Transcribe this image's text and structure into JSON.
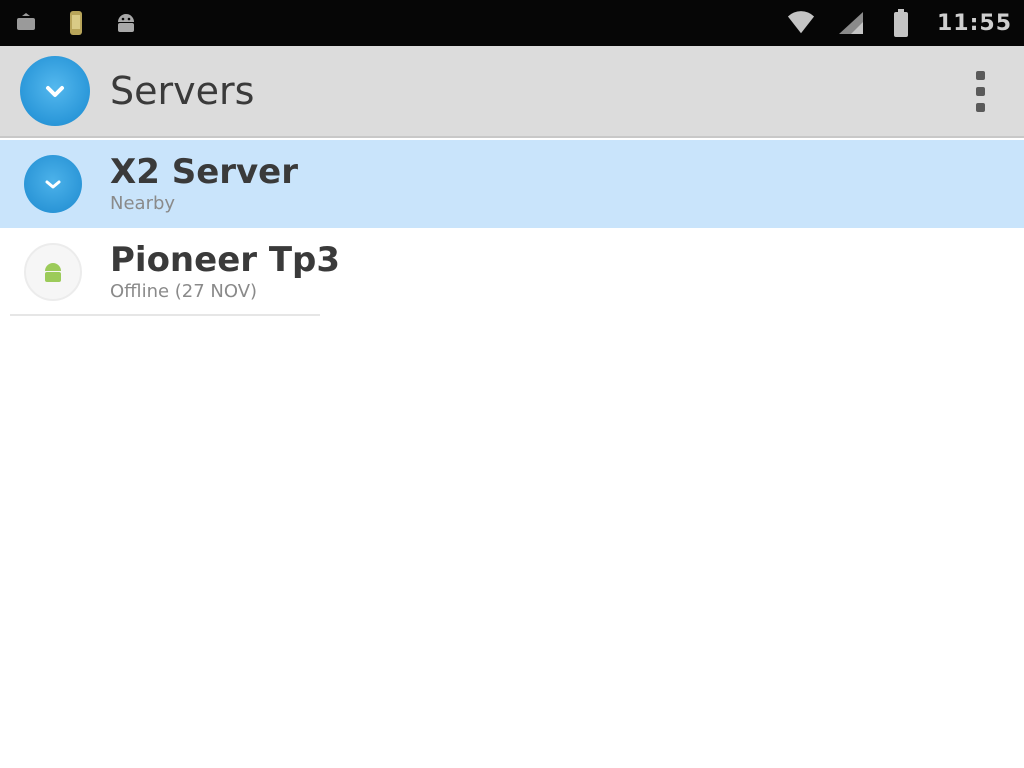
{
  "status_bar": {
    "left_icons": [
      "notification-icon",
      "download-icon",
      "android-icon"
    ],
    "right_icons": [
      "wifi-icon",
      "signal-icon",
      "battery-icon"
    ],
    "time": "11:55"
  },
  "action_bar": {
    "title": "Servers",
    "app_icon": "server-app-icon",
    "overflow_icon": "overflow-menu-icon"
  },
  "servers": [
    {
      "title": "X2 Server",
      "subtitle": "Nearby",
      "icon": "server-icon",
      "selected": true
    },
    {
      "title": "Pioneer Tp3",
      "subtitle": "Offline (27 NOV)",
      "icon": "android-icon",
      "selected": false
    }
  ],
  "colors": {
    "status_bar_bg": "#060606",
    "action_bar_bg": "#dcdcdc",
    "accent_blue": "#2a97d9",
    "selected_row": "#c9e4fb",
    "android_green": "#9ccb5a"
  }
}
